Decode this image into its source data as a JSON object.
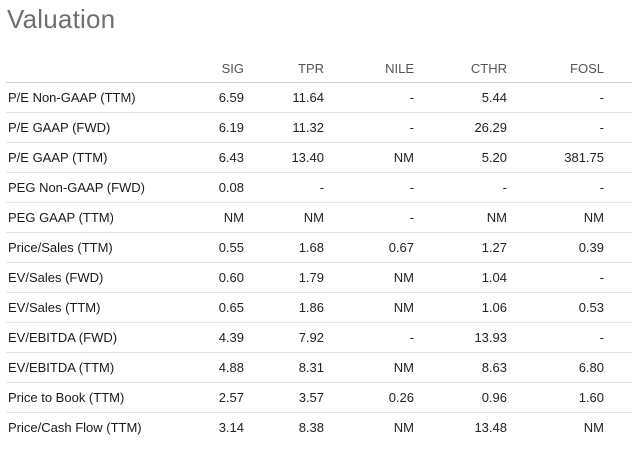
{
  "title": "Valuation",
  "columns": [
    "SIG",
    "TPR",
    "NILE",
    "CTHR",
    "FOSL"
  ],
  "rows": [
    {
      "metric": "P/E Non-GAAP (TTM)",
      "values": [
        "6.59",
        "11.64",
        "-",
        "5.44",
        "-"
      ]
    },
    {
      "metric": "P/E GAAP (FWD)",
      "values": [
        "6.19",
        "11.32",
        "-",
        "26.29",
        "-"
      ]
    },
    {
      "metric": "P/E GAAP (TTM)",
      "values": [
        "6.43",
        "13.40",
        "NM",
        "5.20",
        "381.75"
      ]
    },
    {
      "metric": "PEG Non-GAAP (FWD)",
      "values": [
        "0.08",
        "-",
        "-",
        "-",
        "-"
      ]
    },
    {
      "metric": "PEG GAAP (TTM)",
      "values": [
        "NM",
        "NM",
        "-",
        "NM",
        "NM"
      ]
    },
    {
      "metric": "Price/Sales (TTM)",
      "values": [
        "0.55",
        "1.68",
        "0.67",
        "1.27",
        "0.39"
      ]
    },
    {
      "metric": "EV/Sales (FWD)",
      "values": [
        "0.60",
        "1.79",
        "NM",
        "1.04",
        "-"
      ]
    },
    {
      "metric": "EV/Sales (TTM)",
      "values": [
        "0.65",
        "1.86",
        "NM",
        "1.06",
        "0.53"
      ]
    },
    {
      "metric": "EV/EBITDA (FWD)",
      "values": [
        "4.39",
        "7.92",
        "-",
        "13.93",
        "-"
      ]
    },
    {
      "metric": "EV/EBITDA (TTM)",
      "values": [
        "4.88",
        "8.31",
        "NM",
        "8.63",
        "6.80"
      ]
    },
    {
      "metric": "Price to Book (TTM)",
      "values": [
        "2.57",
        "3.57",
        "0.26",
        "0.96",
        "1.60"
      ]
    },
    {
      "metric": "Price/Cash Flow (TTM)",
      "values": [
        "3.14",
        "8.38",
        "NM",
        "13.48",
        "NM"
      ]
    }
  ]
}
